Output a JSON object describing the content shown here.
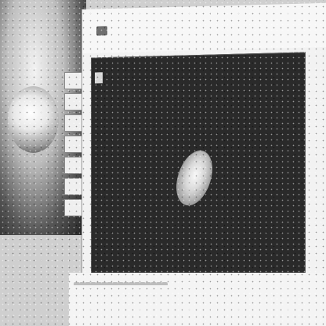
{
  "slide": {
    "heading_line1": "",
    "heading_line2": "",
    "cell_label": "",
    "footer_text": ""
  },
  "ui": {
    "bottom_line1": "",
    "bottom_line2": "",
    "bottom_line3": ""
  }
}
